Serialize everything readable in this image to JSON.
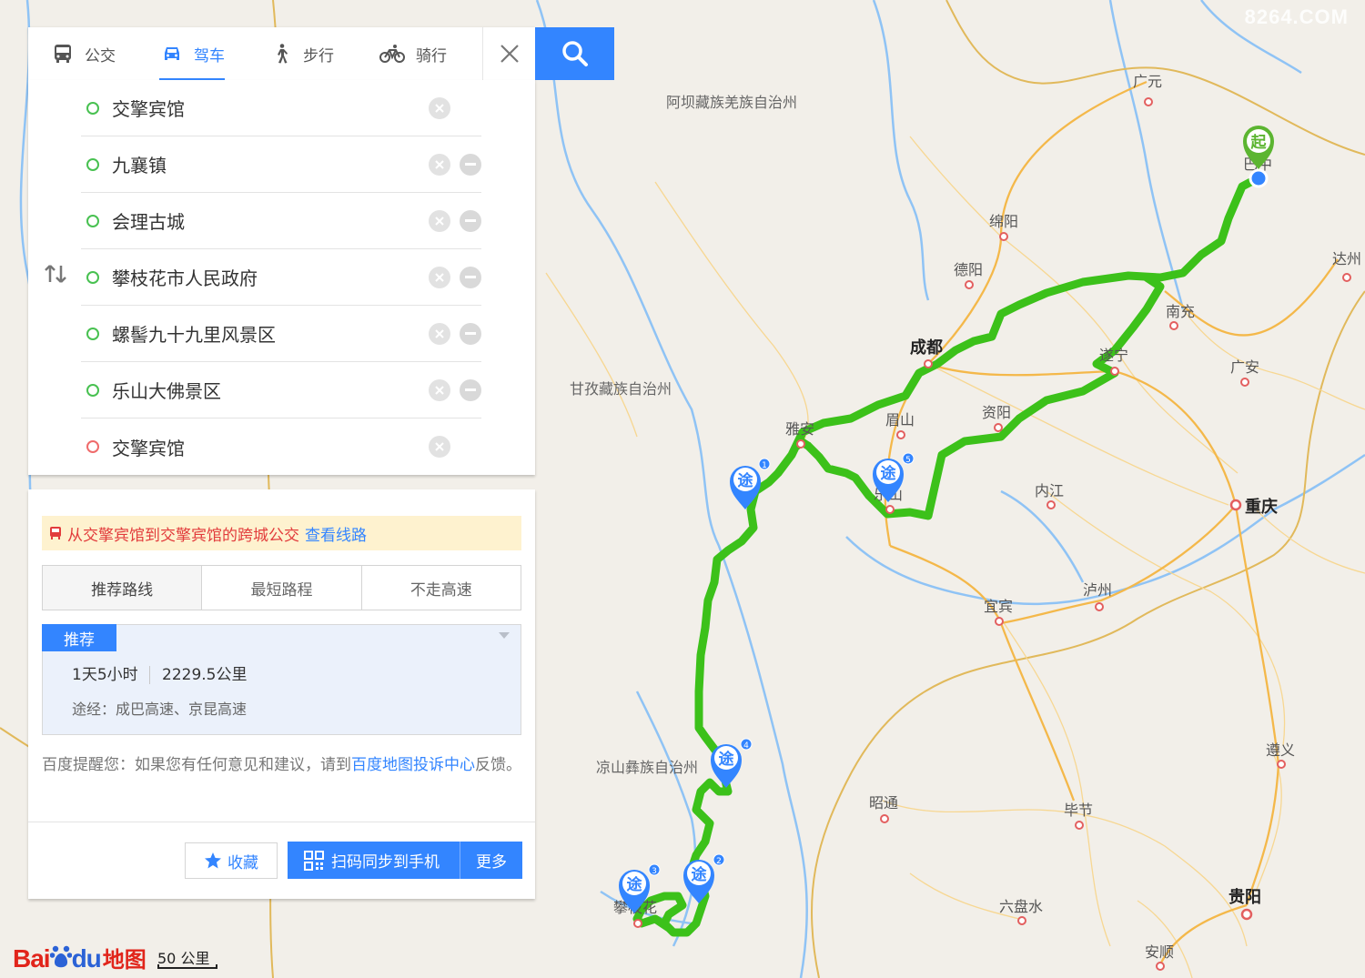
{
  "watermark": "8264.COM",
  "tabs": [
    {
      "label": "公交",
      "icon": "bus-icon"
    },
    {
      "label": "驾车",
      "icon": "car-icon",
      "active": true
    },
    {
      "label": "步行",
      "icon": "walk-icon"
    },
    {
      "label": "骑行",
      "icon": "bike-icon"
    }
  ],
  "waypoints": [
    {
      "name": "交擎宾馆",
      "type": "start"
    },
    {
      "name": "九襄镇",
      "type": "via"
    },
    {
      "name": "会理古城",
      "type": "via"
    },
    {
      "name": "攀枝花市人民政府",
      "type": "via"
    },
    {
      "name": "螺髻九十九里风景区",
      "type": "via"
    },
    {
      "name": "乐山大佛景区",
      "type": "via"
    },
    {
      "name": "交擎宾馆",
      "type": "end"
    }
  ],
  "bus_notice": {
    "text": "从交擎宾馆到交擎宾馆的跨城公交",
    "link": "查看线路"
  },
  "route_tabs": [
    "推荐路线",
    "最短路程",
    "不走高速"
  ],
  "route": {
    "badge": "推荐",
    "time": "1天5小时",
    "distance": "2229.5公里",
    "via": "途经：成巴高速、京昆高速"
  },
  "feedback": {
    "prefix": "百度提醒您：如果您有任何意见和建议，请到",
    "link": "百度地图投诉中心",
    "suffix": "反馈。"
  },
  "actions": {
    "favorite": "收藏",
    "sync": "扫码同步到手机",
    "more": "更多"
  },
  "logo": {
    "bai": "Bai",
    "du": "du",
    "map": "地图"
  },
  "scale": "50 公里",
  "map": {
    "colors": {
      "route": "#3cc11a",
      "marker": "#3385ff",
      "start_marker": "#5cb531"
    },
    "start_marker_label": "起",
    "via_marker_label": "途",
    "via_markers": [
      "1",
      "2",
      "3",
      "4",
      "5"
    ],
    "places": [
      "广元",
      "巴中",
      "绵阳",
      "德阳",
      "达州",
      "南充",
      "成都",
      "遂宁",
      "广安",
      "资阳",
      "眉山",
      "雅安",
      "乐山",
      "内江",
      "重庆",
      "泸州",
      "宜宾",
      "昭通",
      "毕节",
      "遵义",
      "贵阳",
      "六盘水",
      "安顺",
      "攀枝花"
    ],
    "regions": [
      "阿坝藏族羌族自治州",
      "甘孜藏族自治州",
      "凉山彝族自治州"
    ]
  }
}
